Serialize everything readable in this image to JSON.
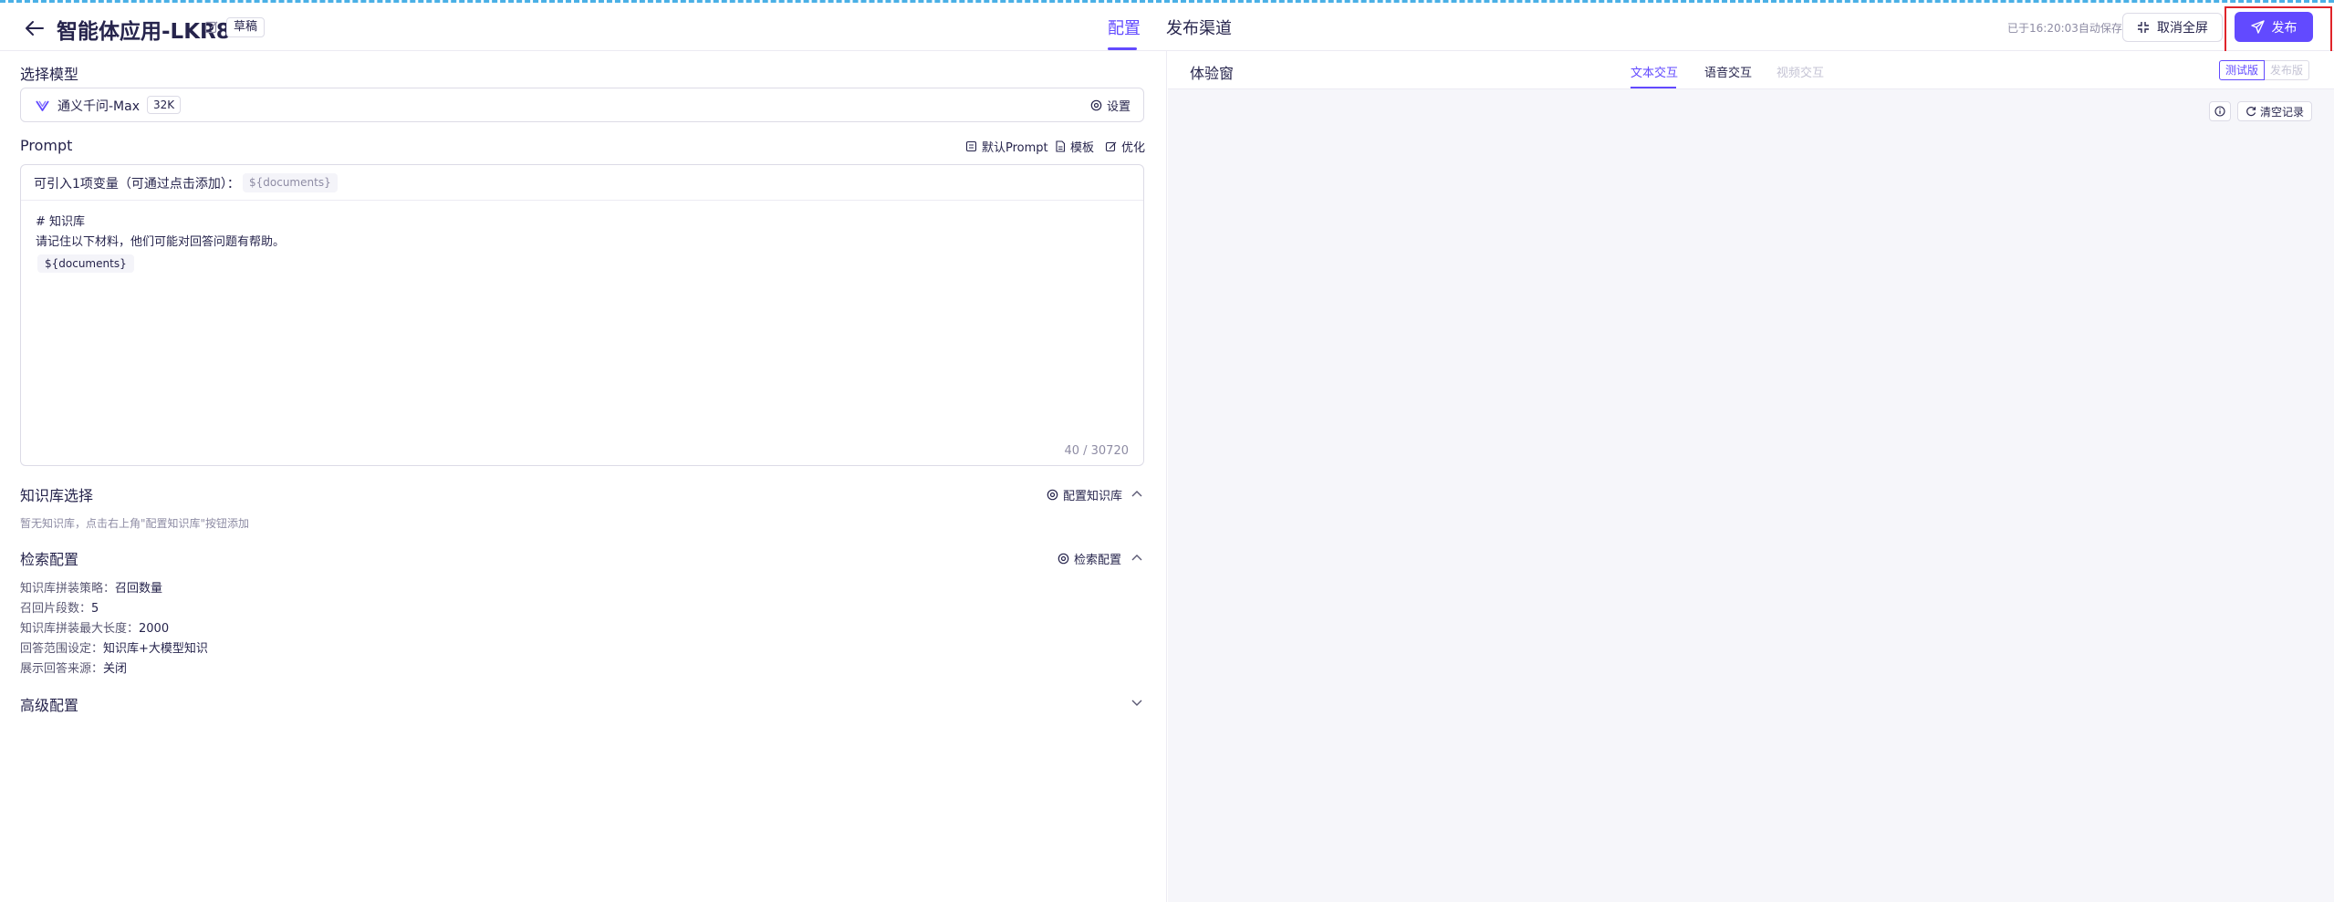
{
  "header": {
    "title": "智能体应用-LKR8",
    "draft_badge": "草稿",
    "tabs": [
      {
        "label": "配置"
      },
      {
        "label": "发布渠道"
      }
    ],
    "saved_text": "已于16:20:03自动保存",
    "exit_fullscreen_label": "取消全屏",
    "publish_label": "发布"
  },
  "model": {
    "section_title": "选择模型",
    "name": "通义千问-Max",
    "context_badge": "32K",
    "settings_label": "设置"
  },
  "prompt": {
    "section_title": "Prompt",
    "default_prompt_label": "默认Prompt",
    "template_label": "模板",
    "optimize_label": "优化",
    "variable_label": "可引入1项变量（可通过点击添加）：",
    "variable_chip": "${documents}",
    "content_line1": "# 知识库",
    "content_line2": "请记住以下材料，他们可能对回答问题有帮助。",
    "content_chip": "${documents}",
    "counter": "40 / 30720"
  },
  "knowledge": {
    "section_title": "知识库选择",
    "config_label": "配置知识库",
    "hint": "暂无知识库，点击右上角\"配置知识库\"按钮添加"
  },
  "retrieval": {
    "section_title": "检索配置",
    "config_label": "检索配置",
    "items": [
      {
        "label": "知识库拼装策略：",
        "value": "召回数量"
      },
      {
        "label": "召回片段数：",
        "value": "5"
      },
      {
        "label": "知识库拼装最大长度：",
        "value": "2000"
      },
      {
        "label": "回答范围设定：",
        "value": "知识库+大模型知识"
      },
      {
        "label": "展示回答来源：",
        "value": "关闭"
      }
    ]
  },
  "advanced": {
    "section_title": "高级配置"
  },
  "experience": {
    "title": "体验窗",
    "modes": [
      {
        "label": "文本交互"
      },
      {
        "label": "语音交互"
      },
      {
        "label": "视频交互"
      }
    ],
    "version_test": "测试版",
    "version_release": "发布版",
    "clear_label": "清空记录"
  },
  "colors": {
    "accent": "#624aff",
    "highlight": "#e0242a"
  }
}
